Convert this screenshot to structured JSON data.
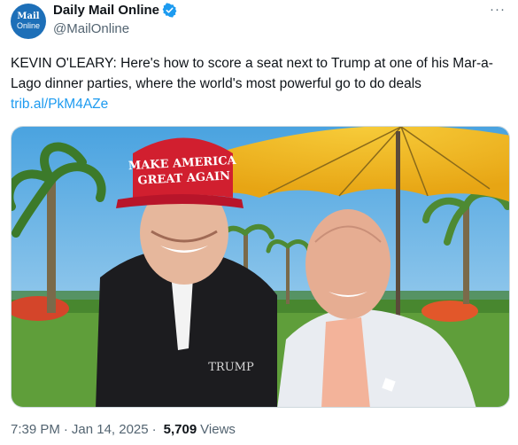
{
  "account": {
    "avatar_line1": "Mail",
    "avatar_line2": "Online",
    "display_name": "Daily Mail Online",
    "handle": "@MailOnline"
  },
  "tweet": {
    "text": "KEVIN O'LEARY: Here's how to score a seat next to Trump at one of his Mar-a-Lago dinner parties, where the world's most powerful go to do deals ",
    "link_text": "trib.al/PkM4AZe"
  },
  "media": {
    "hat_line1": "MAKE AMERICA",
    "hat_line2": "GREAT AGAIN",
    "jacket_logo": "TRUMP"
  },
  "meta": {
    "time": "7:39 PM",
    "date": "Jan 14, 2025",
    "views_count": "5,709",
    "views_label": "Views"
  },
  "colors": {
    "verified": "#1d9bf0",
    "link": "#1d9bf0",
    "avatar": "#1d6fb8",
    "umbrella": "#f2b825",
    "hat": "#d11f2f"
  }
}
